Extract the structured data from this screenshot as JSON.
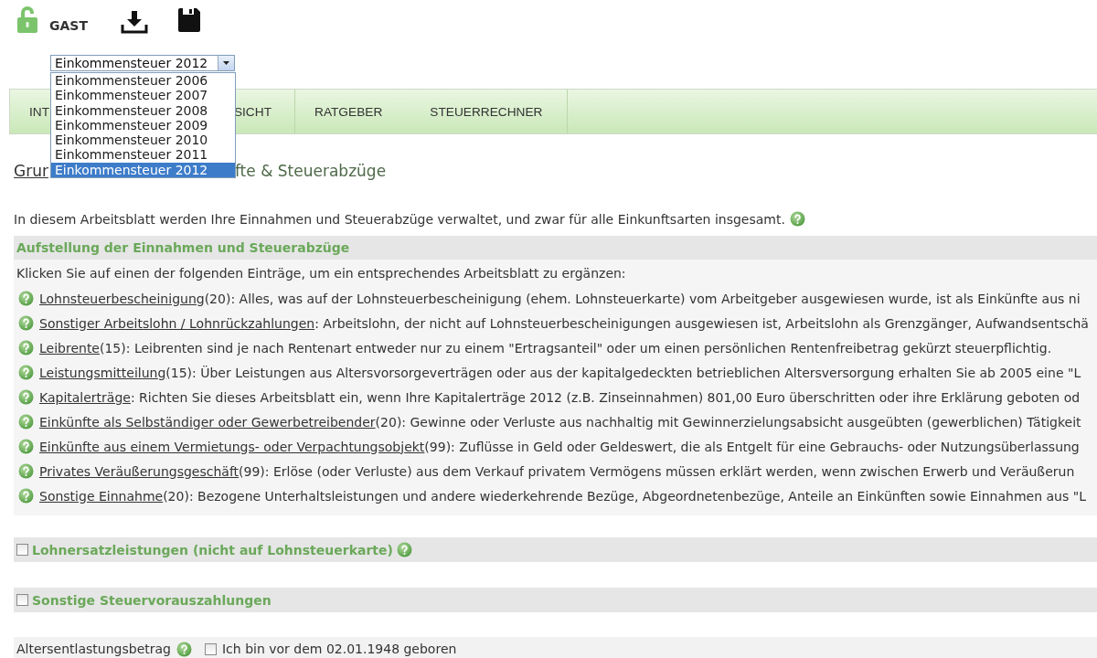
{
  "user": {
    "name": "GAST"
  },
  "year_select": {
    "value": "Einkommensteuer 2012",
    "expanded": true,
    "options": [
      {
        "label": "Einkommensteuer 2006",
        "selected": false
      },
      {
        "label": "Einkommensteuer 2007",
        "selected": false
      },
      {
        "label": "Einkommensteuer 2008",
        "selected": false
      },
      {
        "label": "Einkommensteuer 2009",
        "selected": false
      },
      {
        "label": "Einkommensteuer 2010",
        "selected": false
      },
      {
        "label": "Einkommensteuer 2011",
        "selected": false
      },
      {
        "label": "Einkommensteuer 2012",
        "selected": true
      }
    ]
  },
  "tabs": [
    {
      "label": "INT"
    },
    {
      "label": "SICHT"
    },
    {
      "label": "RATGEBER"
    },
    {
      "label": "STEUERRECHNER"
    }
  ],
  "breadcrumb": [
    {
      "label": "Grur",
      "kind": "link"
    },
    {
      "label": "fte & Steuerabzüge",
      "kind": "current"
    }
  ],
  "intro": "In diesem Arbeitsblatt werden Ihre Einnahmen und Steuerabzüge verwaltet, und zwar für alle Einkunftsarten insgesamt.",
  "income_section": {
    "title": "Aufstellung der Einnahmen und Steuerabzüge",
    "hint": "Klicken Sie auf einen der folgenden Einträge, um ein entsprechendes Arbeitsblatt zu ergänzen:",
    "entries": [
      {
        "link": "Lohnsteuerbescheinigung",
        "text": "(20): Alles, was auf der Lohnsteuerbescheinigung (ehem. Lohnsteuerkarte) vom Arbeitgeber ausgewiesen wurde, ist als Einkünfte aus ni"
      },
      {
        "link": "Sonstiger Arbeitslohn / Lohnrückzahlungen",
        "text": ": Arbeitslohn, der nicht auf Lohnsteuerbescheinigungen ausgewiesen ist, Arbeitslohn als Grenzgänger, Aufwandsentschä"
      },
      {
        "link": "Leibrente",
        "text": "(15): Leibrenten sind je nach Rentenart entweder nur zu einem \"Ertragsanteil\" oder um einen persönlichen Rentenfreibetrag gekürzt steuerpflichtig."
      },
      {
        "link": "Leistungsmitteilung",
        "text": "(15): Über Leistungen aus Altersvorsorgeverträgen oder aus der kapitalgedeckten betrieblichen Altersversorgung erhalten Sie ab 2005 eine \"L"
      },
      {
        "link": "Kapitalerträge",
        "text": ": Richten Sie dieses Arbeitsblatt ein, wenn Ihre Kapitalerträge 2012 (z.B. Zinseinnahmen) 801,00 Euro überschritten oder ihre Erklärung geboten od"
      },
      {
        "link": "Einkünfte als Selbständiger oder Gewerbetreibender",
        "text": "(20): Gewinne oder Verluste aus nachhaltig mit Gewinnerzielungsabsicht ausgeübten (gewerblichen) Tätigkeit"
      },
      {
        "link": "Einkünfte aus einem Vermietungs- oder Verpachtungsobjekt",
        "text": "(99): Zuflüsse in Geld oder Geldeswert, die als Entgelt für eine Gebrauchs- oder Nutzungsüberlassung"
      },
      {
        "link": "Privates Veräußerungsgeschäft",
        "text": "(99): Erlöse (oder Verluste) aus dem Verkauf privatem Vermögens müssen erklärt werden, wenn zwischen Erwerb und Veräußerun"
      },
      {
        "link": "Sonstige Einnahme",
        "text": "(20): Bezogene Unterhaltsleistungen und andere wiederkehrende Bezüge, Abgeordnetenbezüge, Anteile an Einkünften sowie Einnahmen aus \"L"
      }
    ]
  },
  "sections": [
    {
      "title": "Lohnersatzleistungen (nicht auf Lohnsteuerkarte)",
      "checked": false,
      "help": true
    },
    {
      "title": "Sonstige Steuervorauszahlungen",
      "checked": false,
      "help": false
    }
  ],
  "age_relief": {
    "label": "Altersentlastungsbetrag",
    "option": "Ich bin vor dem 02.01.1948 geboren",
    "checked": false
  }
}
